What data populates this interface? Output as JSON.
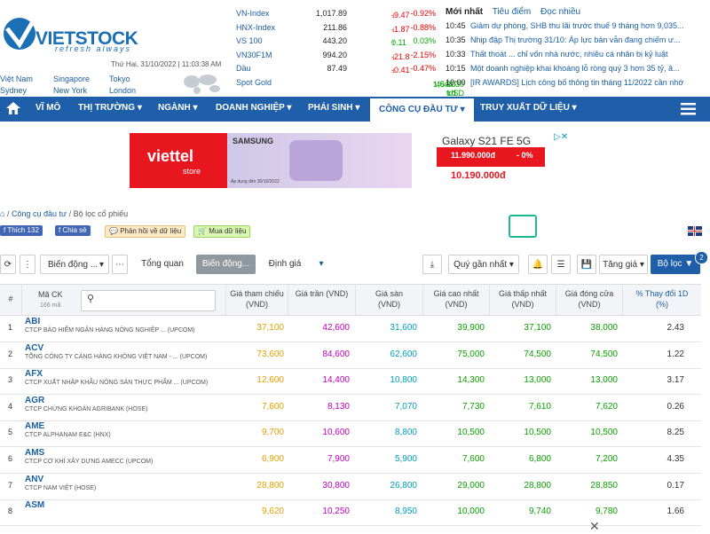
{
  "header": {
    "logo_text": "VIETSTOCK",
    "logo_tagline": "refresh always",
    "date": "Thứ Hai, 31/10/2022 | 11:03:38 AM",
    "cities": [
      "Việt Nam",
      "Singapore",
      "Tokyo",
      "Sydney",
      "New York",
      "London"
    ]
  },
  "indices": [
    {
      "name": "VN-Index",
      "value": "1,017.89",
      "change": "-9.47",
      "pct": "-0.92%",
      "dir": "down"
    },
    {
      "name": "HNX-Index",
      "value": "211.86",
      "change": "-1.87",
      "pct": "-0.88%",
      "dir": "down"
    },
    {
      "name": "VS 100",
      "value": "443.20",
      "change": "0.11",
      "pct": "0.03%",
      "dir": "up"
    },
    {
      "name": "VN30F1M",
      "value": "994.20",
      "change": "-21.8",
      "pct": "-2.15%",
      "dir": "down"
    },
    {
      "name": "Dầu",
      "value": "87.49",
      "change": "-0.41",
      "pct": "-0.47%",
      "dir": "down"
    },
    {
      "name": "Spot Gold",
      "value": "1,644.30 USD",
      "change": "45.10 trđ",
      "pct": "",
      "dir": "none"
    }
  ],
  "news": {
    "tabs": [
      "Mới nhất",
      "Tiêu điểm",
      "Đọc nhiều"
    ],
    "items": [
      {
        "time": "10:45",
        "title": "Giảm dự phòng, SHB thu lãi trước thuế 9 tháng hơn 9,035..."
      },
      {
        "time": "10:35",
        "title": "Nhịp đập Thị trường 31/10: Áp lực bán vẫn đang chiếm ư..."
      },
      {
        "time": "10:33",
        "title": "Thất thoát ... chỉ vốn nhà nước, nhiều cá nhân bị kỷ luật"
      },
      {
        "time": "10:15",
        "title": "Một doanh nghiệp khai khoáng lỗ ròng quý 3 hơn 35 tỷ, â..."
      },
      {
        "time": "10:00",
        "title": "[IR AWARDS] Lịch công bố thông tin tháng 11/2022 cần nhớ"
      }
    ]
  },
  "nav": [
    "VĨ MÔ",
    "THỊ TRƯỜNG ▾",
    "NGÀNH ▾",
    "DOANH NGHIỆP ▾",
    "PHÁI SINH ▾",
    "CÔNG CỤ ĐẦU TƯ ▾",
    "TRUY XUẤT DỮ LIỆU ▾"
  ],
  "ad": {
    "brand": "viettel",
    "store": "store",
    "samsung": "SAMSUNG",
    "model": "Galaxy S21 FE 5G",
    "price_old": "11.990.000đ",
    "discount": "- 0%",
    "price_new": "10.190.000đ",
    "note": "Áp dụng đến 30/10/2022"
  },
  "breadcrumb": [
    "Công cụ đầu tư",
    "Bộ lọc cổ phiếu"
  ],
  "social": {
    "like": "Thích 132",
    "share": "Chia sẻ",
    "feedback": "Phản hồi về dữ liệu",
    "buy": "Mua dữ liệu"
  },
  "toolbar": {
    "filter_select": "Biến động ...",
    "tab_overview": "Tổng quan",
    "tab_volatility": "Biến động...",
    "tab_valuation": "Định giá",
    "period": "Quý gần nhất",
    "sort": "Tăng giá",
    "filter_btn": "Bộ lọc",
    "filter_badge": "2"
  },
  "table": {
    "headers": [
      "#",
      "Mã CK",
      "Giá tham chiếu (VND)",
      "Giá trần (VND)",
      "Giá sàn (VND)",
      "Giá cao nhất (VND)",
      "Giá thấp nhất (VND)",
      "Giá đóng cửa (VND)",
      "% Thay đổi 1D (%)"
    ],
    "count_label": "166 mã",
    "rows": [
      {
        "n": "1",
        "sym": "ABI",
        "name": "CTCP BẢO HIỂM NGÂN HÀNG NÔNG NGHIỆP ... (UPCOM)",
        "ref": "37,100",
        "ceil": "42,600",
        "floor": "31,600",
        "high": "39,900",
        "low": "37,100",
        "close": "38,000",
        "chg": "2.43"
      },
      {
        "n": "2",
        "sym": "ACV",
        "name": "TỔNG CÔNG TY CẢNG HÀNG KHÔNG VIỆT NAM - ... (UPCOM)",
        "ref": "73,600",
        "ceil": "84,600",
        "floor": "62,600",
        "high": "75,000",
        "low": "74,500",
        "close": "74,500",
        "chg": "1.22"
      },
      {
        "n": "3",
        "sym": "AFX",
        "name": "CTCP XUẤT NHẬP KHẨU NÔNG SẢN THỰC PHẨM ... (UPCOM)",
        "ref": "12,600",
        "ceil": "14,400",
        "floor": "10,800",
        "high": "14,300",
        "low": "13,000",
        "close": "13,000",
        "chg": "3.17"
      },
      {
        "n": "4",
        "sym": "AGR",
        "name": "CTCP CHỨNG KHOÁN AGRIBANK (HOSE)",
        "ref": "7,600",
        "ceil": "8,130",
        "floor": "7,070",
        "high": "7,730",
        "low": "7,610",
        "close": "7,620",
        "chg": "0.26"
      },
      {
        "n": "5",
        "sym": "AME",
        "name": "CTCP ALPHANAM E&C (HNX)",
        "ref": "9,700",
        "ceil": "10,600",
        "floor": "8,800",
        "high": "10,500",
        "low": "10,500",
        "close": "10,500",
        "chg": "8.25"
      },
      {
        "n": "6",
        "sym": "AMS",
        "name": "CTCP CƠ KHÍ XÂY DỰNG AMECC (UPCOM)",
        "ref": "6,900",
        "ceil": "7,900",
        "floor": "5,900",
        "high": "7,600",
        "low": "6,800",
        "close": "7,200",
        "chg": "4.35"
      },
      {
        "n": "7",
        "sym": "ANV",
        "name": "CTCP NAM VIỆT (HOSE)",
        "ref": "28,800",
        "ceil": "30,800",
        "floor": "26,800",
        "high": "29,000",
        "low": "28,800",
        "close": "28,850",
        "chg": "0.17"
      },
      {
        "n": "8",
        "sym": "ASM",
        "name": "",
        "ref": "9,620",
        "ceil": "10,250",
        "floor": "8,950",
        "high": "10,000",
        "low": "9,740",
        "close": "9,780",
        "chg": "1.66"
      }
    ]
  }
}
